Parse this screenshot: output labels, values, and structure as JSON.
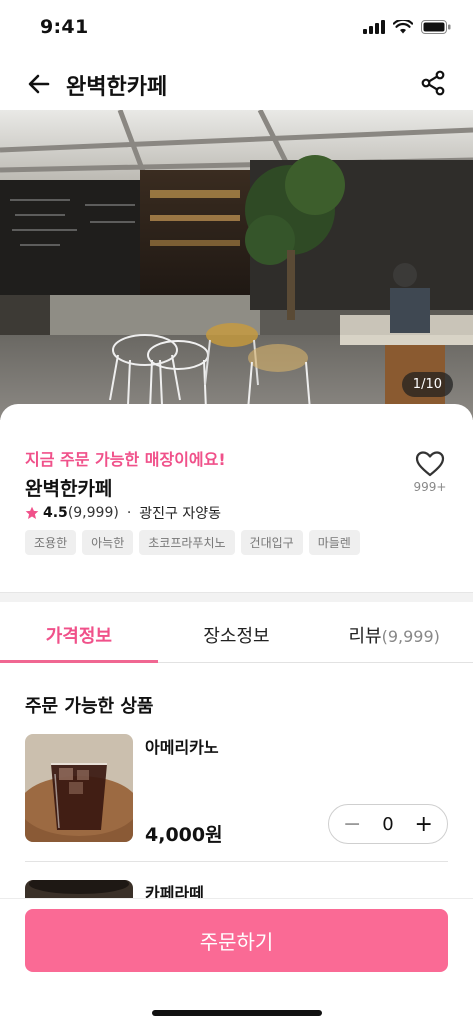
{
  "status_bar": {
    "time": "9:41"
  },
  "header": {
    "title": "완벽한카페"
  },
  "hero": {
    "photo_counter": "1/10"
  },
  "info": {
    "order_available": "지금 주문 가능한 매장이에요!",
    "shop_name": "완벽한카페",
    "rating": "4.5",
    "rating_count": "(9,999)",
    "separator": "·",
    "location": "광진구 자양동",
    "tags": [
      "조용한",
      "아늑한",
      "초코프라푸치노",
      "건대입구",
      "마들렌"
    ],
    "like_count": "999+"
  },
  "tabs": [
    {
      "label": "가격정보",
      "count": ""
    },
    {
      "label": "장소정보",
      "count": ""
    },
    {
      "label": "리뷰",
      "count": "(9,999)"
    }
  ],
  "products": {
    "title": "주문 가능한 상품",
    "items": [
      {
        "name": "아메리카노",
        "price": "4,000원",
        "quantity": "0",
        "minus": "−",
        "plus": "+"
      },
      {
        "name": "카페라떼"
      }
    ]
  },
  "bottom": {
    "order_button": "주문하기"
  },
  "colors": {
    "accent": "#f0518a",
    "button": "#fa6a95"
  },
  "icons": [
    "back-arrow-icon",
    "share-icon",
    "heart-icon",
    "star-icon",
    "signal-icon",
    "wifi-icon",
    "battery-icon"
  ]
}
